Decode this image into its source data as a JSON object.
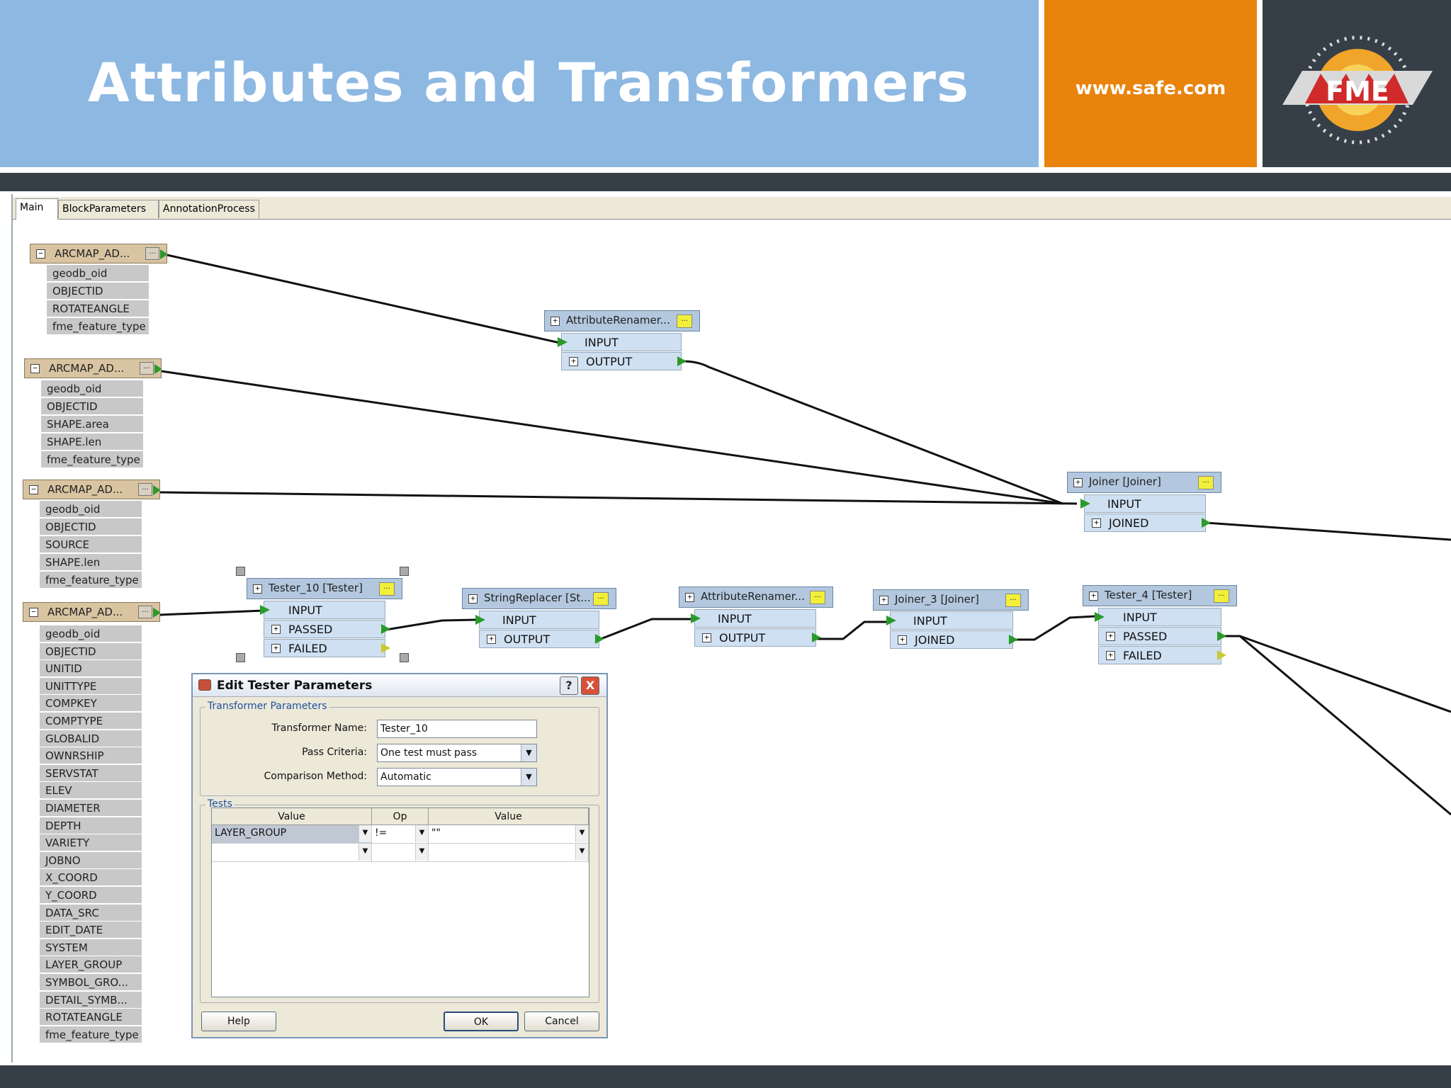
{
  "slide": {
    "title": "Attributes and Transformers",
    "url": "www.safe.com",
    "logo_text": "FME"
  },
  "tabs": [
    "Main",
    "BlockParameters",
    "AnnotationProcess"
  ],
  "features": [
    {
      "name": "ARCMAP_AD...",
      "attrs": [
        "geodb_oid",
        "OBJECTID",
        "ROTATEANGLE",
        "fme_feature_type"
      ]
    },
    {
      "name": "ARCMAP_AD...",
      "attrs": [
        "geodb_oid",
        "OBJECTID",
        "SHAPE.area",
        "SHAPE.len",
        "fme_feature_type"
      ]
    },
    {
      "name": "ARCMAP_AD...",
      "attrs": [
        "geodb_oid",
        "OBJECTID",
        "SOURCE",
        "SHAPE.len",
        "fme_feature_type"
      ]
    },
    {
      "name": "ARCMAP_AD...",
      "attrs": [
        "geodb_oid",
        "OBJECTID",
        "UNITID",
        "UNITTYPE",
        "COMPKEY",
        "COMPTYPE",
        "GLOBALID",
        "OWNRSHIP",
        "SERVSTAT",
        "ELEV",
        "DIAMETER",
        "DEPTH",
        "VARIETY",
        "JOBNO",
        "X_COORD",
        "Y_COORD",
        "DATA_SRC",
        "EDIT_DATE",
        "SYSTEM",
        "LAYER_GROUP",
        "SYMBOL_GRO...",
        "DETAIL_SYMB...",
        "ROTATEANGLE",
        "fme_feature_type"
      ]
    }
  ],
  "transformers": [
    {
      "name": "AttributeRenamer...",
      "ports": [
        "INPUT",
        "OUTPUT"
      ]
    },
    {
      "name": "Joiner [Joiner]",
      "ports": [
        "INPUT",
        "JOINED"
      ]
    },
    {
      "name": "Tester_10 [Tester]",
      "ports": [
        "INPUT",
        "PASSED",
        "FAILED"
      ]
    },
    {
      "name": "StringReplacer [St...",
      "ports": [
        "INPUT",
        "OUTPUT"
      ]
    },
    {
      "name": "AttributeRenamer...",
      "ports": [
        "INPUT",
        "OUTPUT"
      ]
    },
    {
      "name": "Joiner_3 [Joiner]",
      "ports": [
        "INPUT",
        "JOINED"
      ]
    },
    {
      "name": "Tester_4 [Tester]",
      "ports": [
        "INPUT",
        "PASSED",
        "FAILED"
      ]
    }
  ],
  "dialog": {
    "title": "Edit Tester Parameters",
    "group_params": "Transformer Parameters",
    "name_label": "Transformer Name:",
    "name_value": "Tester_10",
    "criteria_label": "Pass Criteria:",
    "criteria_value": "One test must pass",
    "method_label": "Comparison Method:",
    "method_value": "Automatic",
    "group_tests": "Tests",
    "columns": [
      "Value",
      "Op",
      "Value"
    ],
    "row1": {
      "left": "LAYER_GROUP",
      "op": "!=",
      "right": "\"\""
    },
    "help": "Help",
    "ok": "OK",
    "cancel": "Cancel",
    "help_icon": "?",
    "close_icon": "X"
  },
  "colors": {
    "header_blue": "#8db8e2",
    "orange": "#e8830c",
    "dark": "#363f47"
  }
}
